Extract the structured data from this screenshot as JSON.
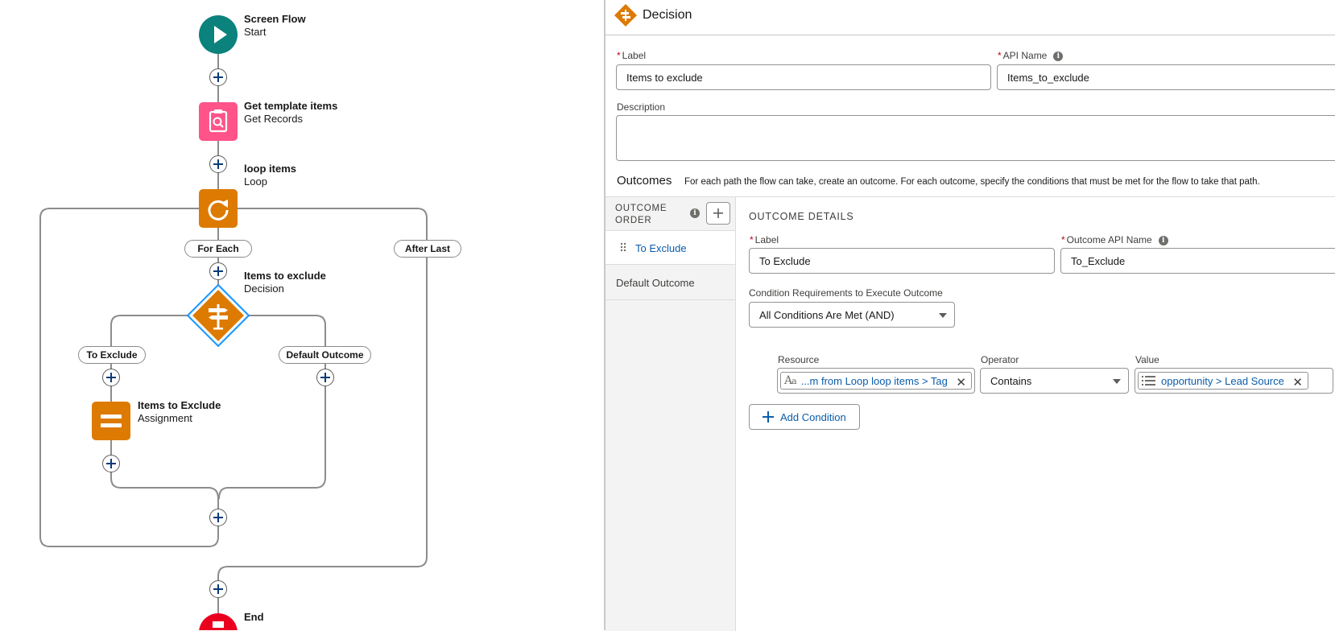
{
  "flow": {
    "start": {
      "title": "Screen Flow",
      "subtitle": "Start"
    },
    "get_records": {
      "title": "Get template items",
      "subtitle": "Get Records"
    },
    "loop": {
      "title": "loop items",
      "subtitle": "Loop",
      "for_each_label": "For Each",
      "after_last_label": "After Last"
    },
    "decision": {
      "title": "Items to exclude",
      "subtitle": "Decision",
      "outcome_a": "To Exclude",
      "outcome_b": "Default Outcome"
    },
    "assignment": {
      "title": "Items to Exclude",
      "subtitle": "Assignment"
    },
    "end": {
      "title": "End"
    }
  },
  "colors": {
    "start": "#0b827c",
    "get_records": "#ff538a",
    "logic": "#dd7a01",
    "end": "#ea001e",
    "link": "#0b5cab",
    "connector": "#8c8c8c"
  },
  "panel": {
    "header_title": "Decision",
    "label_field": {
      "label": "Label",
      "value": "Items to exclude"
    },
    "api_field": {
      "label": "API Name",
      "value": "Items_to_exclude"
    },
    "description": {
      "label": "Description",
      "value": ""
    },
    "outcomes": {
      "heading": "Outcomes",
      "help": "For each path the flow can take, create an outcome. For each outcome, specify the conditions that must be met for the flow to take that path.",
      "order_label_line1": "OUTCOME",
      "order_label_line2": "ORDER",
      "items": [
        "To Exclude",
        "Default Outcome"
      ]
    },
    "details": {
      "heading": "OUTCOME DETAILS",
      "label_field": {
        "label": "Label",
        "value": "To Exclude"
      },
      "api_field": {
        "label": "Outcome API Name",
        "value": "To_Exclude"
      },
      "requirements": {
        "label": "Condition Requirements to Execute Outcome",
        "value": "All Conditions Are Met (AND)"
      },
      "condition": {
        "resource_label": "Resource",
        "resource_value": "...m from Loop loop items > Tag",
        "operator_label": "Operator",
        "operator_value": "Contains",
        "value_label": "Value",
        "value_value": "opportunity > Lead Source"
      },
      "add_condition_label": "Add Condition"
    }
  }
}
